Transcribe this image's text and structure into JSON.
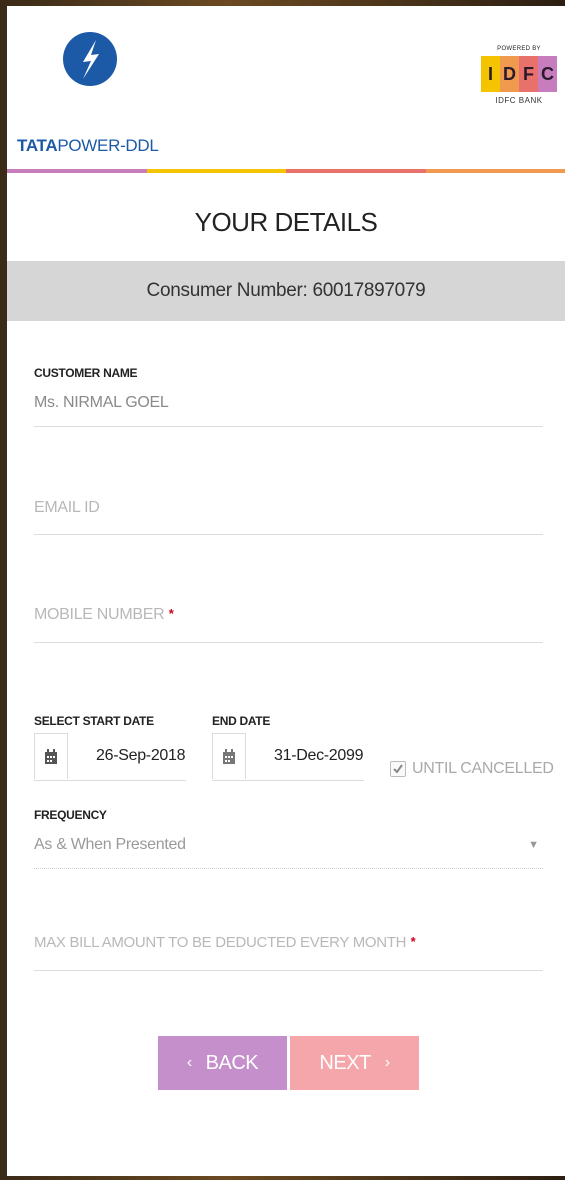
{
  "header": {
    "brand_tata_bold": "TATA",
    "brand_tata_rest": "POWER-DDL",
    "powered_by": "POWERED BY",
    "idfc_letters": [
      "I",
      "D",
      "F",
      "C"
    ],
    "idfc_bank": "IDFC BANK"
  },
  "colors": {
    "stripe": [
      "#c77dbd",
      "#f4c400",
      "#e8716c",
      "#f09a50"
    ],
    "idfc": [
      "#f4c400",
      "#f09a50",
      "#e8716c",
      "#c77dbd"
    ],
    "back_button": "#c58fcb",
    "next_button": "#f4a6aa",
    "tata_blue": "#1c5aa8"
  },
  "page": {
    "title": "YOUR DETAILS",
    "consumer_number": "Consumer Number: 60017897079"
  },
  "form": {
    "customer_name_label": "CUSTOMER NAME",
    "customer_name_value": "Ms. NIRMAL  GOEL",
    "email_placeholder": "EMAIL ID",
    "mobile_placeholder": "MOBILE NUMBER",
    "required_mark": "*",
    "start_date_label": "SELECT START DATE",
    "start_date_value": "26-Sep-2018",
    "end_date_label": "END DATE",
    "end_date_value": "31-Dec-2099",
    "until_cancelled_label": "UNTIL CANCELLED",
    "until_cancelled_checked": true,
    "frequency_label": "FREQUENCY",
    "frequency_value": "As & When Presented",
    "max_amount_placeholder": "MAX BILL AMOUNT TO BE DEDUCTED EVERY MONTH"
  },
  "buttons": {
    "back": "BACK",
    "next": "NEXT"
  }
}
